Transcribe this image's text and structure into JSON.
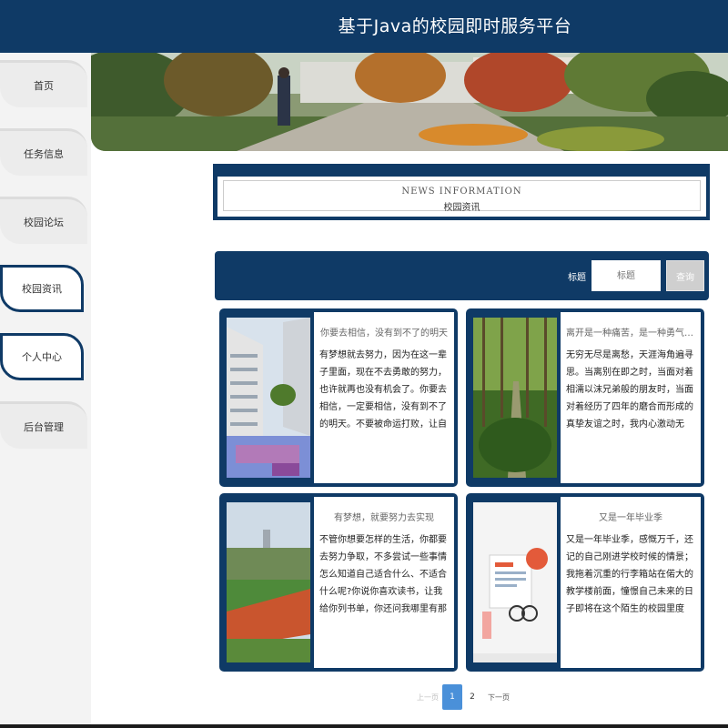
{
  "header": {
    "title": "基于Java的校园即时服务平台"
  },
  "sidebar": {
    "items": [
      {
        "label": "首页"
      },
      {
        "label": "任务信息"
      },
      {
        "label": "校园论坛"
      },
      {
        "label": "校园资讯"
      },
      {
        "label": "个人中心"
      },
      {
        "label": "后台管理"
      }
    ]
  },
  "section": {
    "title_en": "NEWS   INFORMATION",
    "title_cn": "校园资讯"
  },
  "search": {
    "label": "标题",
    "placeholder": "标题",
    "button": "查询"
  },
  "news": [
    {
      "title": "你要去相信，没有到不了的明天",
      "summary": "有梦想就去努力，因为在这一辈子里面，现在不去勇敢的努力，也许就再也没有机会了。你要去相信，一定要相信，没有到不了的明天。不要被命运打败，让自己变得更强大。不管你现在…"
    },
    {
      "title": "离开是一种痛苦，是一种勇气，但同…",
      "summary": "无穷无尽是离愁，天涯海角遍寻思。当离别在即之时，当面对着相濡以沫兄弟般的朋友时，当面对着经历了四年的磨合而形成的真挚友谊之时，我内心激动无语，说一声再见，道一声珍重都很…"
    },
    {
      "title": "有梦想，就要努力去实现",
      "summary": "不管你想要怎样的生活，你都要去努力争取，不多尝试一些事情怎么知道自己适合什么、不适合什么呢?你说你喜欢读书，让我给你列书单，你还问我哪里有那么多时间看书 你说自己梦想的…"
    },
    {
      "title": "又是一年毕业季",
      "summary": "又是一年毕业季，感慨万千，还记的自己刚进学校时候的情景；我拖着沉重的行李箱站在偌大的教学楼前面，憧憬自己未来的日子即将在这个陌生的校园里度过，而如今斗转星移，浮光掠影…"
    }
  ],
  "pagination": {
    "prev": "上一页",
    "current": "1",
    "next_page": "2",
    "next": "下一页"
  }
}
